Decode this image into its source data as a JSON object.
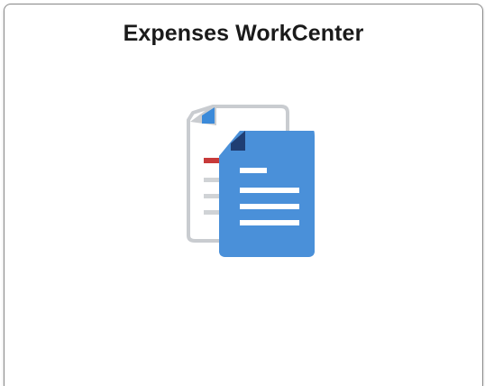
{
  "tile": {
    "title": "Expenses WorkCenter",
    "icon": "documents-icon"
  },
  "colors": {
    "title_text": "#1a1a1a",
    "tile_border": "#8a8a8a",
    "doc_back_fill": "#ffffff",
    "doc_back_outline": "#c9ccd0",
    "doc_back_fold": "#3b8ad9",
    "doc_back_red_line": "#c73a3a",
    "doc_back_gray_lines": "#d0d3d6",
    "doc_front_fill": "#4a90d9",
    "doc_front_fold": "#1f3e73",
    "doc_front_lines": "#ffffff"
  }
}
